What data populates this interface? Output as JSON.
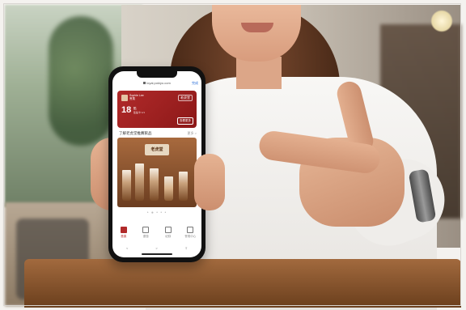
{
  "phone_screen": {
    "url": "loyal.pokiyo.com",
    "url_action": "完成",
    "card": {
      "member_name": "Sophie Lee",
      "member_level": "會員",
      "brand_logo": "老虎堂",
      "points": "18",
      "points_unit": "點",
      "points_sub": "集點卡 1/1",
      "card_button": "查看更多"
    },
    "promo": {
      "title": "了解老虎堂推薦飲品",
      "more": "更多 >",
      "banner_badge": "老虎堂"
    },
    "carousel_dots": "• ● • • •",
    "tabs": [
      {
        "label": "首頁",
        "icon": "home-icon"
      },
      {
        "label": "優惠",
        "icon": "coupon-icon"
      },
      {
        "label": "紀錄",
        "icon": "history-icon"
      },
      {
        "label": "會員中心",
        "icon": "member-icon"
      }
    ],
    "nav": {
      "back": "<",
      "forward": ">",
      "share": "⇧"
    }
  },
  "colors": {
    "brand_red": "#b12a2a",
    "screen_bg": "#ffffff"
  }
}
